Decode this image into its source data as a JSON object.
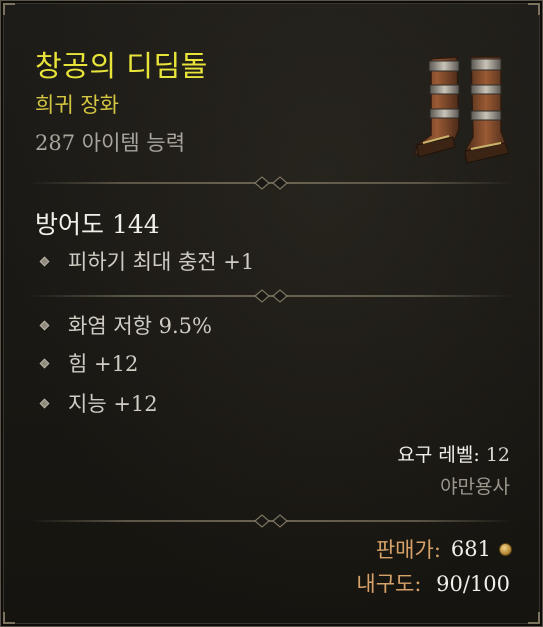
{
  "item": {
    "name": "창공의 디딤돌",
    "rarity": "희귀 장화",
    "item_power": "287 아이템 능력",
    "name_color": "#e8e43a",
    "rarity_color": "#d4c640",
    "image_icon": "boots-icon"
  },
  "armor": {
    "label": "방어도 144"
  },
  "implicit_stats": [
    "피하기 최대 충전 +1"
  ],
  "affixes": [
    "화염 저항 9.5%",
    "힘 +12",
    "지능 +12"
  ],
  "requirements": {
    "level_label": "요구 레벨:",
    "level_value": "12",
    "class": "야만용사"
  },
  "footer": {
    "sell_label": "판매가:",
    "sell_value": "681",
    "currency_icon": "gold-coin-icon",
    "durability_label": "내구도:",
    "durability_value": "90/100"
  }
}
